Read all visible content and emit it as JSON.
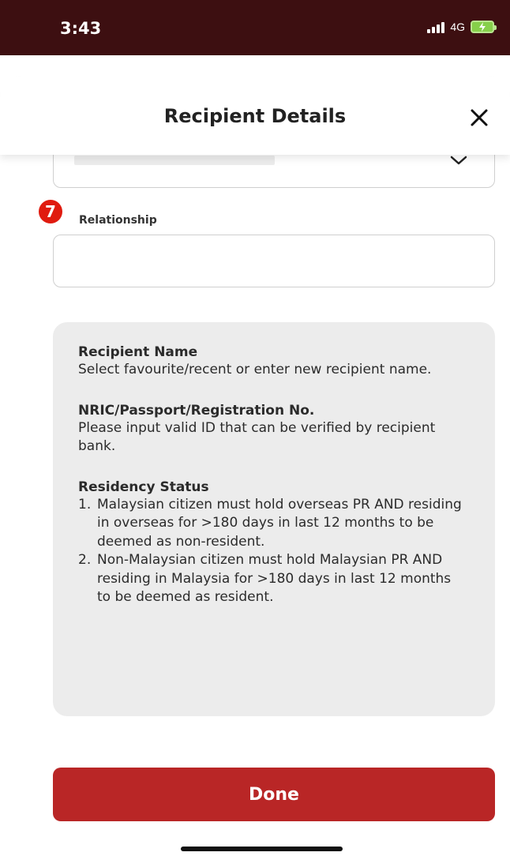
{
  "status_bar": {
    "time": "3:43",
    "network": "4G"
  },
  "header": {
    "title": "Recipient Details"
  },
  "relationship": {
    "badge": "7",
    "label": "Relationship",
    "value": "",
    "placeholder": ""
  },
  "info": {
    "sections": [
      {
        "heading": "Recipient Name",
        "text": "Select favourite/recent or enter new recipient name."
      },
      {
        "heading": "NRIC/Passport/Registration No.",
        "text": "Please input valid ID that can be verified by recipient bank."
      }
    ],
    "residency": {
      "heading": "Residency Status",
      "items": [
        {
          "num": "1.",
          "text": "Malaysian citizen must hold overseas PR AND residing in overseas for >180 days in last 12 months to be deemed as non-resident."
        },
        {
          "num": "2.",
          "text": "Non-Malaysian citizen must hold Malaysian PR AND residing in Malaysia for >180 days in last 12 months to be deemed as resident."
        }
      ]
    }
  },
  "done_button": {
    "label": "Done"
  },
  "colors": {
    "status_bar": "#3d0f11",
    "primary_button": "#b92626",
    "step_badge": "#e01b0f",
    "info_panel": "#ececec"
  },
  "icons": {
    "close": "close-icon",
    "dropdown": "chevron-down-icon",
    "signal": "signal-icon",
    "battery": "battery-charging-icon"
  }
}
